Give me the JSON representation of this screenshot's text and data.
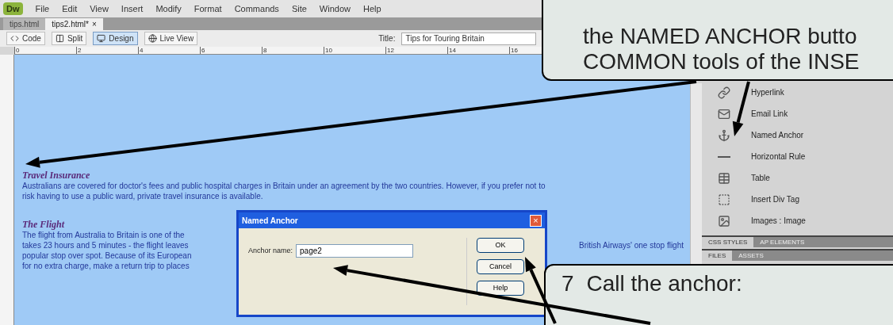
{
  "app": {
    "logo": "Dw",
    "menu": [
      "File",
      "Edit",
      "View",
      "Insert",
      "Modify",
      "Format",
      "Commands",
      "Site",
      "Window",
      "Help"
    ],
    "doc_tabs": [
      {
        "label": "tips.html",
        "selected": false
      },
      {
        "label": "tips2.html*",
        "selected": true,
        "close": "×"
      }
    ],
    "toolbar": {
      "buttons": [
        {
          "label": "Code",
          "selected": false
        },
        {
          "label": "Split",
          "selected": false
        },
        {
          "label": "Design",
          "selected": true
        },
        {
          "label": "Live View",
          "selected": false
        }
      ],
      "title_label": "Title:",
      "title_value": "Tips for Touring Britain"
    },
    "ruler_ticks": [
      "0",
      "2",
      "4",
      "6",
      "8",
      "10",
      "12",
      "14",
      "16"
    ],
    "document": [
      {
        "heading": "Travel Insurance",
        "lines": [
          {
            "left": "Australians are covered for doctor's fees and public hospital charges in Britain under an agreement by the two countries. However, if you prefer not to"
          },
          {
            "left": "risk having to use a public ward, private travel insurance is available."
          }
        ]
      },
      {
        "heading": "The Flight",
        "lines": [
          {
            "left": "The flight from Australia to Britain is one of the"
          },
          {
            "left": "takes 23 hours and 5 minutes - the flight leaves",
            "right": "British Airways' one stop flight"
          },
          {
            "left": "popular stop over spot. Because of its European"
          },
          {
            "left": "for no extra charge, make a return trip to places"
          }
        ]
      }
    ],
    "insert_panel": {
      "items": [
        {
          "label": "Hyperlink",
          "kind": "link"
        },
        {
          "label": "Email Link",
          "kind": "mail"
        },
        {
          "label": "Named Anchor",
          "kind": "anchor"
        },
        {
          "label": "Horizontal Rule",
          "kind": "rule"
        },
        {
          "label": "Table",
          "kind": "table"
        },
        {
          "label": "Insert Div Tag",
          "kind": "div"
        },
        {
          "label": "Images : Image",
          "kind": "image"
        }
      ]
    },
    "panel_groups": [
      {
        "tabs": [
          {
            "label": "CSS STYLES",
            "selected": true
          },
          {
            "label": "AP ELEMENTS",
            "selected": false
          }
        ]
      },
      {
        "tabs": [
          {
            "label": "FILES",
            "selected": true
          },
          {
            "label": "ASSETS",
            "selected": false
          }
        ]
      }
    ]
  },
  "dialog": {
    "title": "Named Anchor",
    "close": "×",
    "field_label": "Anchor name:",
    "field_value": "page2",
    "buttons": [
      "OK",
      "Cancel",
      "Help"
    ]
  },
  "callouts": [
    {
      "lines": [
        "the NAMED ANCHOR butto",
        "COMMON tools of the INSE"
      ]
    },
    {
      "step": "7",
      "lines": [
        "Call the anchor:"
      ]
    }
  ]
}
